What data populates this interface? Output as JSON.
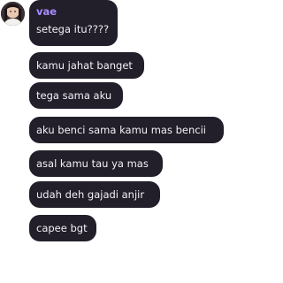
{
  "chat": {
    "sender_name": "vae",
    "messages": [
      "setega itu????",
      "kamu jahat banget",
      "tega sama aku",
      "aku benci sama kamu mas bencii",
      "asal kamu tau ya mas",
      "udah deh gajadi anjir",
      "capee bgt"
    ]
  },
  "colors": {
    "bubble_bg": "#221f2b",
    "bubble_text": "#f2f0f7",
    "sender_name": "#a98bff",
    "page_bg": "#ffffff"
  },
  "icons": {
    "avatar": "avatar-photo"
  }
}
